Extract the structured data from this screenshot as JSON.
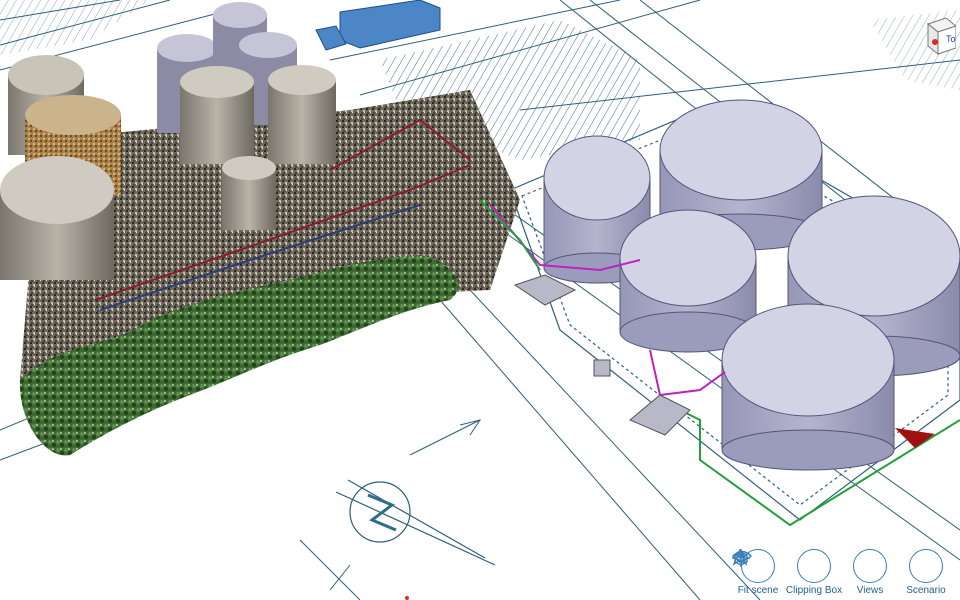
{
  "viewer": {
    "navcube_top_label": "To"
  },
  "toolbar": {
    "items": [
      {
        "label": "Fit scene",
        "icon": "fit-scene-icon"
      },
      {
        "label": "Clipping Box",
        "icon": "clipping-box-icon"
      },
      {
        "label": "Views",
        "icon": "views-icon"
      },
      {
        "label": "Scenario",
        "icon": "scenario-icon"
      }
    ]
  },
  "colors": {
    "linework": "#2e5f7a",
    "tank_fill": "#a9a9c6",
    "tank_top": "#d3d3e6",
    "pipe_magenta": "#c020c0",
    "pipe_green": "#22a03a",
    "accent": "#3a7fb6",
    "building_blue": "#4d86c6",
    "marker_red": "#a01010"
  }
}
